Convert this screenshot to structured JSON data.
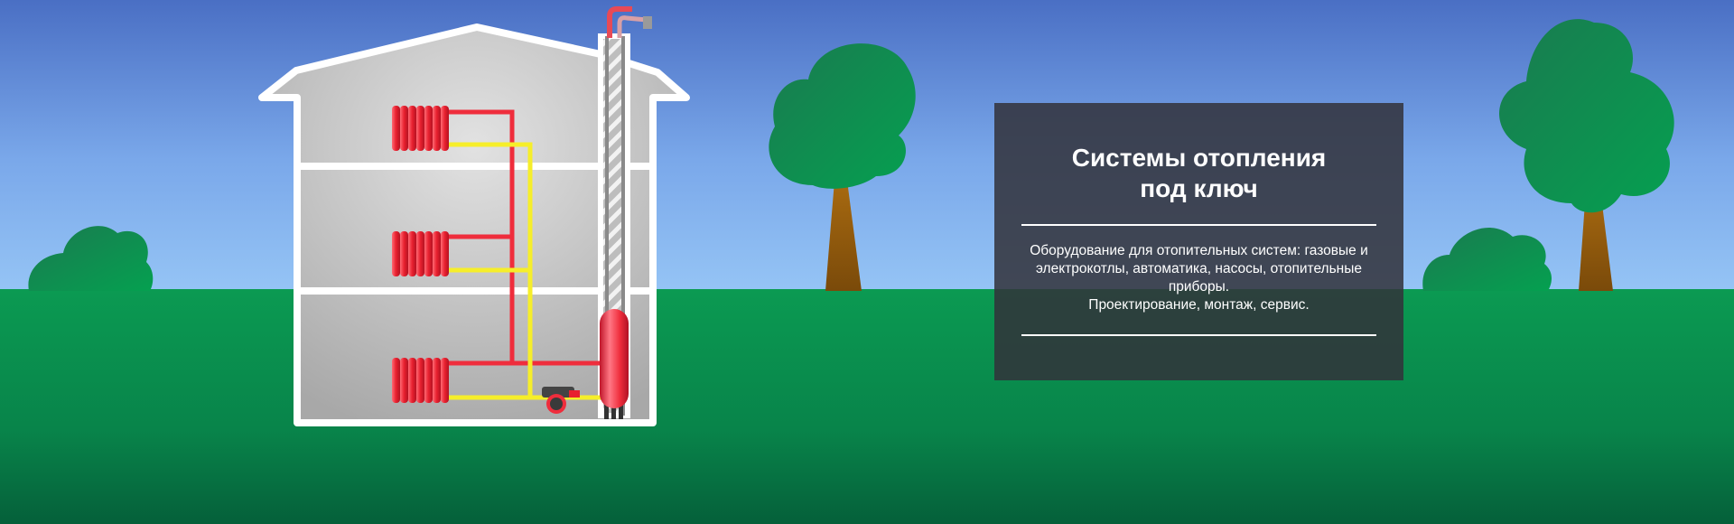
{
  "banner": {
    "title_line1": "Системы отопления",
    "title_line2": "под ключ",
    "description_line1": "Оборудование для отопительных систем: газовые и электрокотлы, автоматика, насосы, отопительные приборы.",
    "description_line2": "Проектирование, монтаж, сервис."
  },
  "colors": {
    "sky_top": "#4a6fc4",
    "sky_bottom": "#93c3f4",
    "grass": "#0a9a50",
    "hot_pipe": "#ef2d3c",
    "cold_pipe": "#f6ee2a",
    "panel_bg": "#32323a"
  },
  "icons": {
    "radiator": "radiator-icon",
    "pump": "circulation-pump-icon",
    "tank": "expansion-tank-icon",
    "chimney": "chimney-icon",
    "tree": "tree-icon",
    "bush": "bush-icon"
  }
}
